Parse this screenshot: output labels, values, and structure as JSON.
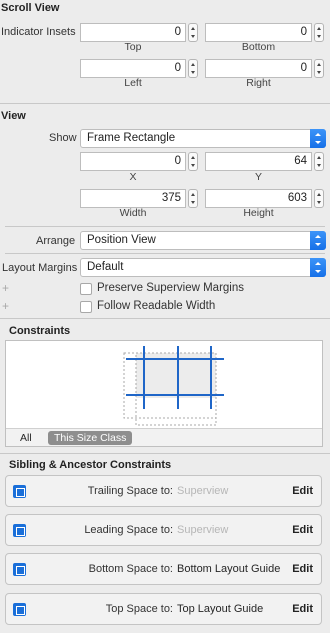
{
  "scroll_view": {
    "title": "Scroll View",
    "indicator_insets_label": "Indicator Insets",
    "top_value": "0",
    "top_label": "Top",
    "bottom_value": "0",
    "bottom_label": "Bottom",
    "left_value": "0",
    "left_label": "Left",
    "right_value": "0",
    "right_label": "Right"
  },
  "view": {
    "title": "View",
    "show_label": "Show",
    "show_value": "Frame Rectangle",
    "x_value": "0",
    "x_label": "X",
    "y_value": "64",
    "y_label": "Y",
    "width_value": "375",
    "width_label": "Width",
    "height_value": "603",
    "height_label": "Height",
    "arrange_label": "Arrange",
    "arrange_value": "Position View",
    "layout_margins_label": "Layout Margins",
    "layout_margins_value": "Default",
    "preserve_label": "Preserve Superview Margins",
    "follow_label": "Follow Readable Width"
  },
  "constraints": {
    "title": "Constraints",
    "all_label": "All",
    "size_class_label": "This Size Class"
  },
  "sibling": {
    "title": "Sibling & Ancestor Constraints",
    "items": [
      {
        "label": "Trailing Space to:",
        "target": "Superview",
        "edit": "Edit",
        "icon": "trailing-space-icon",
        "dim": true
      },
      {
        "label": "Leading Space to:",
        "target": "Superview",
        "edit": "Edit",
        "icon": "leading-space-icon",
        "dim": true
      },
      {
        "label": "Bottom Space to:",
        "target": "Bottom Layout Guide",
        "edit": "Edit",
        "icon": "bottom-space-icon",
        "dim": false
      },
      {
        "label": "Top Space to:",
        "target": "Top Layout Guide",
        "edit": "Edit",
        "icon": "top-space-icon",
        "dim": false
      }
    ]
  },
  "colors": {
    "accent": "#1a6fd9",
    "constraint_line": "#1f66c8"
  }
}
